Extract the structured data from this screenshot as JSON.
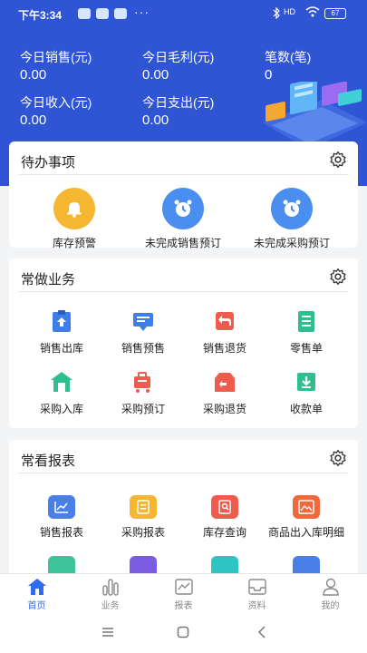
{
  "status": {
    "time": "下午3:34",
    "dots": "···",
    "signal": "HD",
    "battery": "67"
  },
  "summary": [
    {
      "label": "今日销售(元)",
      "value": "0.00"
    },
    {
      "label": "今日毛利(元)",
      "value": "0.00"
    },
    {
      "label": "笔数(笔)",
      "value": "0"
    },
    {
      "label": "今日收入(元)",
      "value": "0.00"
    },
    {
      "label": "今日支出(元)",
      "value": "0.00"
    }
  ],
  "todo": {
    "title": "待办事项",
    "items": [
      {
        "label": "库存预警",
        "color": "#f5b731"
      },
      {
        "label": "未完成销售预订",
        "color": "#4a8ff0"
      },
      {
        "label": "未完成采购预订",
        "color": "#4a8ff0"
      }
    ]
  },
  "business": {
    "title": "常做业务",
    "items": [
      {
        "label": "销售出库",
        "color": "#3f7de8"
      },
      {
        "label": "销售预售",
        "color": "#3f7de8"
      },
      {
        "label": "销售退货",
        "color": "#ef5b4c"
      },
      {
        "label": "零售单",
        "color": "#2fbf8f"
      },
      {
        "label": "采购入库",
        "color": "#2fbf8f"
      },
      {
        "label": "采购预订",
        "color": "#ef5b4c"
      },
      {
        "label": "采购退货",
        "color": "#ef5b4c"
      },
      {
        "label": "收款单",
        "color": "#2fbf8f"
      }
    ]
  },
  "reports": {
    "title": "常看报表",
    "items": [
      {
        "label": "销售报表",
        "color": "#4a7fe8"
      },
      {
        "label": "采购报表",
        "color": "#f5b731"
      },
      {
        "label": "库存查询",
        "color": "#ef5b4c"
      },
      {
        "label": "商品出入库明细",
        "color": "#f0683c"
      }
    ],
    "partial_colors": [
      "#3fc39a",
      "#7b5ce0",
      "#2ec4c4",
      "#4a7fe8"
    ]
  },
  "tabs": [
    {
      "label": "首页",
      "active": true
    },
    {
      "label": "业务",
      "active": false
    },
    {
      "label": "报表",
      "active": false
    },
    {
      "label": "资料",
      "active": false
    },
    {
      "label": "我的",
      "active": false
    }
  ]
}
